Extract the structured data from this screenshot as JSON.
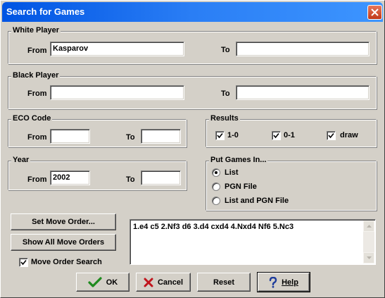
{
  "window": {
    "title": "Search for Games"
  },
  "white_player": {
    "group_title": "White Player",
    "from_label": "From",
    "from_value": "Kasparov",
    "to_label": "To",
    "to_value": ""
  },
  "black_player": {
    "group_title": "Black Player",
    "from_label": "From",
    "from_value": "",
    "to_label": "To",
    "to_value": ""
  },
  "eco_code": {
    "group_title": "ECO Code",
    "from_label": "From",
    "from_value": "",
    "to_label": "To",
    "to_value": ""
  },
  "results": {
    "group_title": "Results",
    "options": [
      {
        "label": "1-0",
        "checked": true
      },
      {
        "label": "0-1",
        "checked": true
      },
      {
        "label": "draw",
        "checked": true
      }
    ]
  },
  "year": {
    "group_title": "Year",
    "from_label": "From",
    "from_value": "2002",
    "to_label": "To",
    "to_value": ""
  },
  "put_games_in": {
    "group_title": "Put Games In...",
    "options": [
      {
        "label": "List",
        "selected": true
      },
      {
        "label": "PGN File",
        "selected": false
      },
      {
        "label": "List and PGN File",
        "selected": false
      }
    ]
  },
  "move_order": {
    "set_button": "Set Move Order...",
    "show_all_button": "Show All Move Orders",
    "search_checkbox_label": "Move Order Search",
    "search_checked": true,
    "moves_text": "1.e4 c5 2.Nf3 d6 3.d4 cxd4 4.Nxd4 Nf6 5.Nc3"
  },
  "footer": {
    "ok": "OK",
    "cancel": "Cancel",
    "reset": "Reset",
    "help": "Help"
  },
  "icons": {
    "ok": "checkmark-icon",
    "cancel": "x-icon",
    "help": "question-icon",
    "close": "close-icon"
  },
  "colors": {
    "titlebar": "#0054e3",
    "face": "#d4d0c8",
    "ok_check": "#1e8a1e",
    "cancel_x": "#c0141c",
    "help_q": "#1e3c9c"
  }
}
